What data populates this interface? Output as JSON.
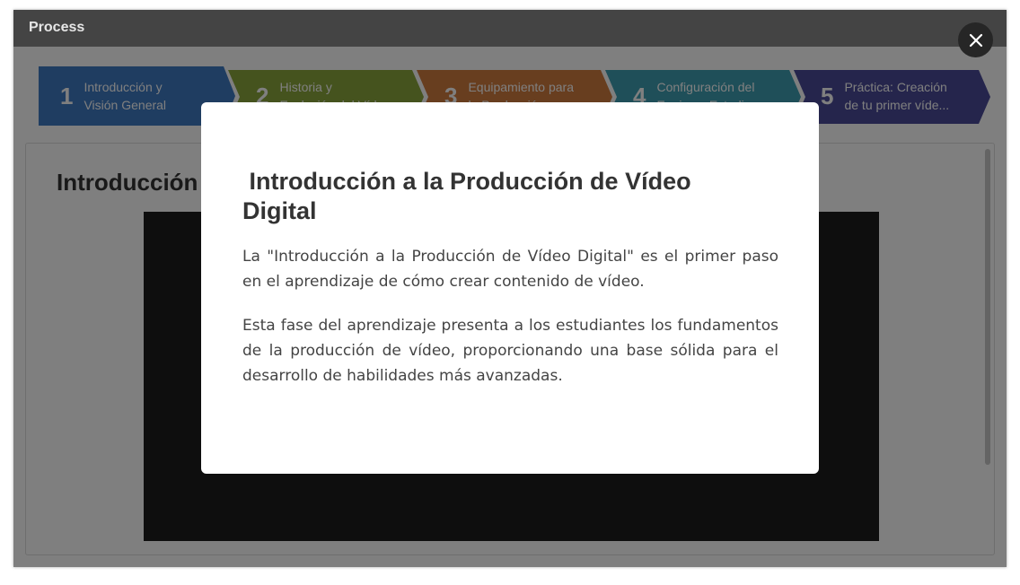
{
  "window": {
    "title": "Process"
  },
  "colors": {
    "titlebar": "#444444",
    "step_1": "#3f7ac2",
    "step_2": "#8aa63c",
    "step_3": "#d17c3f",
    "step_4": "#3f9fb3",
    "step_5": "#4a4a98",
    "overlay": "rgba(0,0,0,0.5)",
    "close_button": "#262626"
  },
  "steps": [
    {
      "number": "1",
      "line1": "Introducción y",
      "line2": "Visión General",
      "color": "#3f7ac2"
    },
    {
      "number": "2",
      "line1": "Historia y",
      "line2": "Evolución del Vídeo",
      "color": "#8aa63c"
    },
    {
      "number": "3",
      "line1": "Equipamiento para",
      "line2": "la Producción",
      "color": "#d17c3f"
    },
    {
      "number": "4",
      "line1": "Configuración del",
      "line2": "Equipo y Estudio",
      "color": "#3f9fb3"
    },
    {
      "number": "5",
      "line1": "Práctica: Creación",
      "line2": "de tu primer víde...",
      "color": "#4a4a98"
    }
  ],
  "content": {
    "heading": "Introducción a la Producción de Vídeo Digital"
  },
  "modal": {
    "title": "Introducción a la Producción de Vídeo Digital",
    "paragraphs": [
      "La \"Introducción a la Producción de Vídeo Digital\" es el primer paso en el aprendizaje de cómo crear contenido de vídeo.",
      "Esta fase del aprendizaje presenta a los estudiantes los fundamentos de la producción de vídeo, proporcionando una base sólida para el desarrollo de habilidades más avanzadas."
    ],
    "close_icon": "close-icon"
  }
}
